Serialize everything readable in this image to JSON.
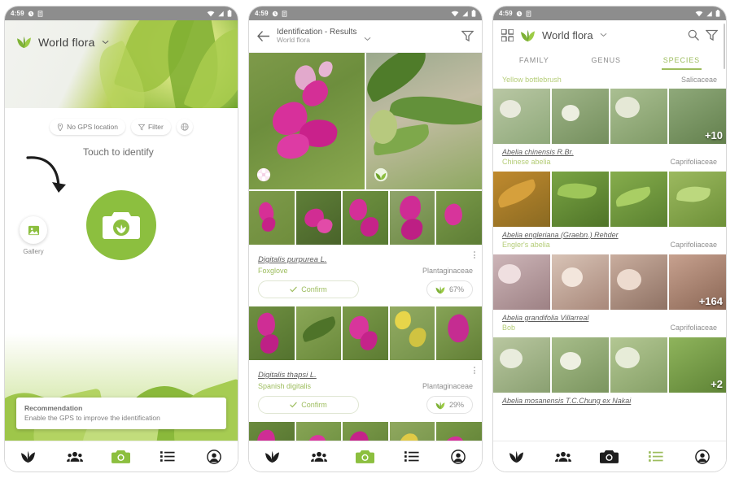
{
  "status_bar": {
    "time": "4:59",
    "icons": [
      "alarm-icon",
      "app-icon",
      "wifi-icon",
      "signal-icon",
      "battery-icon"
    ]
  },
  "colors": {
    "brand_green": "#8cbf3f",
    "accent_light_green": "#9dbd5e",
    "text_muted": "#8e8e8e",
    "status_bar": "#8d8d8d"
  },
  "panel1": {
    "app_title": "World flora",
    "chips": [
      {
        "label": "No GPS location",
        "icon": "location-pin-icon"
      },
      {
        "label": "Filter",
        "icon": "filter-icon"
      },
      {
        "label": "",
        "icon": "globe-icon"
      }
    ],
    "cta_label": "Touch to identify",
    "shutter_icon": "camera-plant-icon",
    "gallery_label": "Gallery",
    "toast": {
      "title": "Recommendation",
      "message": "Enable the GPS to improve the identification"
    }
  },
  "panel2": {
    "title": "Identification - Results",
    "subtitle": "World flora",
    "back_icon": "back-arrow-icon",
    "filter_icon": "filter-icon",
    "results": [
      {
        "scientific_name": "Digitalis purpurea L.",
        "common_name": "Foxglove",
        "family": "Plantaginaceae",
        "confirm_label": "Confirm",
        "score": "67%"
      },
      {
        "scientific_name": "Digitalis thapsi L.",
        "common_name": "Spanish digitalis",
        "family": "Plantaginaceae",
        "confirm_label": "Confirm",
        "score": "29%"
      }
    ]
  },
  "panel3": {
    "grid_icon": "grid-icon",
    "app_title": "World flora",
    "search_icon": "search-icon",
    "filter_icon": "filter-icon",
    "tabs": [
      {
        "label": "FAMILY",
        "active": false
      },
      {
        "label": "GENUS",
        "active": false
      },
      {
        "label": "SPECIES",
        "active": true
      }
    ],
    "partial_row": {
      "common_name": "Yellow bottlebrush",
      "family": "Salicaceae"
    },
    "species": [
      {
        "scientific_name": "Abelia chinensis R.Br.",
        "common_name": "Chinese abelia",
        "family": "Caprifoliaceae",
        "more_count": "+10"
      },
      {
        "scientific_name": "Abelia engleriana (Graebn.) Rehder",
        "common_name": "Engler's abelia",
        "family": "Caprifoliaceae",
        "more_count": ""
      },
      {
        "scientific_name": "Abelia grandifolia Villarreal",
        "common_name": "Bob",
        "family": "Caprifoliaceae",
        "more_count": "+164"
      },
      {
        "scientific_name": "Abelia mosanensis T.C.Chung ex Nakai",
        "common_name": "",
        "family": "",
        "more_count": "+2"
      }
    ]
  },
  "bottom_nav": {
    "items": [
      {
        "name": "plants",
        "icon": "plant-icon"
      },
      {
        "name": "community",
        "icon": "people-icon"
      },
      {
        "name": "camera",
        "icon": "camera-icon"
      },
      {
        "name": "list",
        "icon": "list-icon"
      },
      {
        "name": "profile",
        "icon": "account-icon"
      }
    ]
  }
}
